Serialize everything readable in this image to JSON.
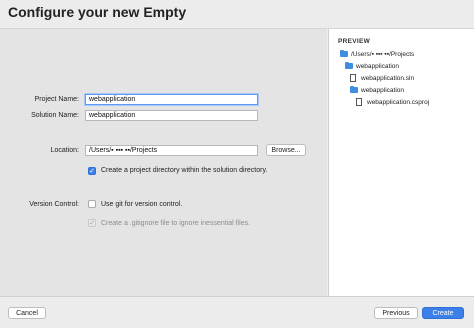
{
  "window": {
    "title": "Configure your new Empty"
  },
  "form": {
    "project_name_label": "Project Name:",
    "project_name_value": "webapplication",
    "solution_name_label": "Solution Name:",
    "solution_name_value": "webapplication",
    "location_label": "Location:",
    "location_value": "/Users/▪ ▪▪▪ ▪▪/Projects",
    "browse_label": "Browse...",
    "create_dir_label": "Create a project directory within the solution directory.",
    "create_dir_checked": true,
    "version_control_label": "Version Control:",
    "use_git_label": "Use git for version control.",
    "use_git_checked": false,
    "gitignore_label": "Create a .gitignore file to ignore inessential files.",
    "gitignore_checked": true,
    "gitignore_enabled": false
  },
  "preview": {
    "title": "PREVIEW",
    "tree": [
      {
        "label": "/Users/▪ ▪▪▪ ▪▪/Projects",
        "icon": "folder-icon"
      },
      {
        "label": "webapplication",
        "icon": "folder-icon"
      },
      {
        "label": "webapplication.sln",
        "icon": "file-icon"
      },
      {
        "label": "webapplication",
        "icon": "folder-icon"
      },
      {
        "label": "webapplication.csproj",
        "icon": "file-icon"
      }
    ]
  },
  "footer": {
    "cancel_label": "Cancel",
    "previous_label": "Previous",
    "create_label": "Create"
  },
  "colors": {
    "accent": "#3d7fe8",
    "folder": "#3f8ee0",
    "panel_bg": "#e4e4e4",
    "preview_bg": "#ffffff"
  }
}
